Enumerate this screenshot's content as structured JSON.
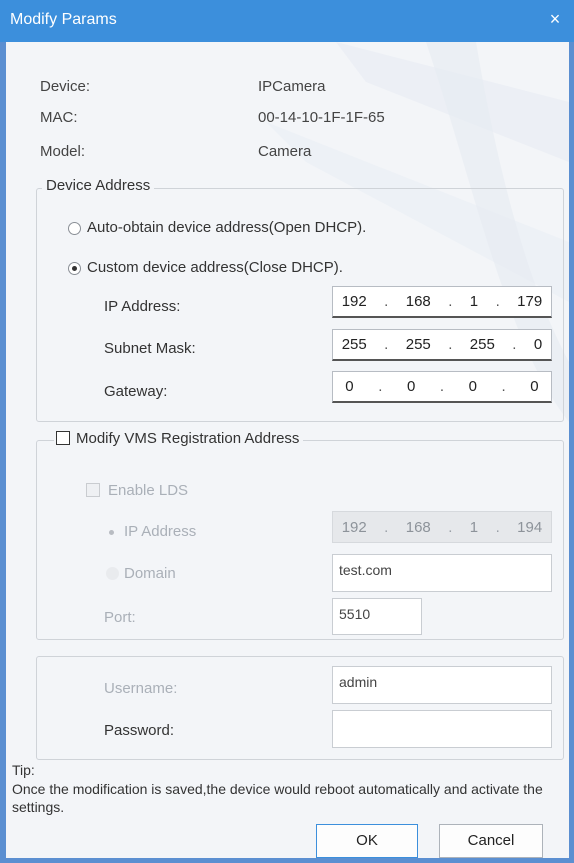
{
  "window": {
    "title": "Modify Params",
    "close_glyph": "×",
    "accent": "#3c8fdc"
  },
  "info": {
    "device_label": "Device:",
    "device_value": "IPCamera",
    "mac_label": "MAC:",
    "mac_value": "00-14-10-1F-1F-65",
    "model_label": "Model:",
    "model_value": "Camera"
  },
  "device_address": {
    "legend": "Device Address",
    "auto_label": "Auto-obtain device address(Open DHCP).",
    "custom_label": "Custom device address(Close DHCP).",
    "selected": "custom",
    "ip_label": "IP Address:",
    "ip": [
      "192",
      "168",
      "1",
      "179"
    ],
    "mask_label": "Subnet Mask:",
    "mask": [
      "255",
      "255",
      "255",
      "0"
    ],
    "gateway_label": "Gateway:",
    "gateway": [
      "0",
      "0",
      "0",
      "0"
    ]
  },
  "vms": {
    "legend": "Modify VMS Registration Address",
    "checked": false,
    "enable_lds_label": "Enable LDS",
    "ip_label": "IP Address",
    "ip": [
      "192",
      "168",
      "1",
      "194"
    ],
    "domain_label": "Domain",
    "domain_value": "test.com",
    "port_label": "Port:",
    "port_value": "5510"
  },
  "credentials": {
    "username_label": "Username:",
    "username_value": "admin",
    "password_label": "Password:",
    "password_value": ""
  },
  "tip": {
    "heading": "Tip:",
    "text": "Once the modification is saved,the device would reboot automatically and activate the settings."
  },
  "buttons": {
    "ok": "OK",
    "cancel": "Cancel"
  }
}
